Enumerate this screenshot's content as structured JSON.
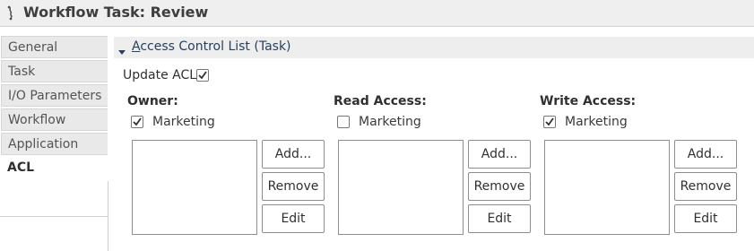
{
  "window": {
    "title": "Workflow Task: Review",
    "icon": "workflow-task-icon"
  },
  "tabs": [
    {
      "label": "General",
      "active": false
    },
    {
      "label": "Task",
      "active": false
    },
    {
      "label": "I/O Parameters",
      "active": false
    },
    {
      "label": "Workflow",
      "active": false
    },
    {
      "label": "Application",
      "active": false
    },
    {
      "label": "ACL",
      "active": true
    }
  ],
  "section": {
    "title_before": "Access Control List (Task)",
    "expanded": true
  },
  "update_acl": {
    "label": "Update ACL",
    "checked": true
  },
  "columns": [
    {
      "heading": "Owner:",
      "checkbox_label": "Marketing",
      "checked": true,
      "buttons": {
        "add": "Add...",
        "remove": "Remove",
        "edit": "Edit"
      }
    },
    {
      "heading": "Read Access:",
      "checkbox_label": "Marketing",
      "checked": false,
      "buttons": {
        "add": "Add...",
        "remove": "Remove",
        "edit": "Edit"
      }
    },
    {
      "heading": "Write Access:",
      "checkbox_label": "Marketing",
      "checked": true,
      "buttons": {
        "add": "Add...",
        "remove": "Remove",
        "edit": "Edit"
      }
    }
  ],
  "colors": {
    "section_title": "#27405e",
    "tab_bg": "#e9e9e9",
    "header_bg": "#efefef"
  }
}
